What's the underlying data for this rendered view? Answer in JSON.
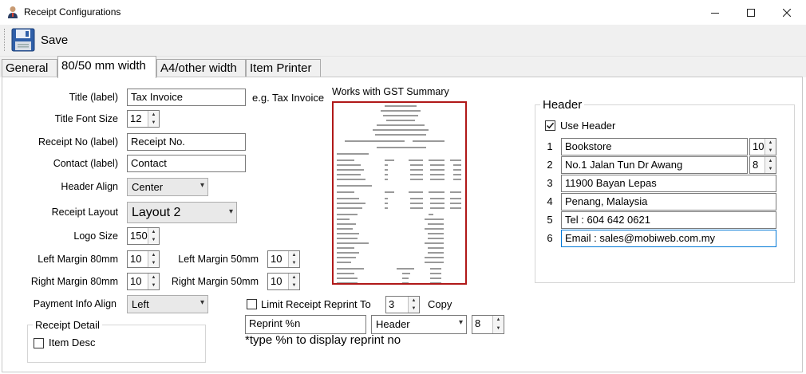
{
  "window": {
    "title": "Receipt Configurations"
  },
  "toolbar": {
    "save_label": "Save"
  },
  "tabs": [
    {
      "label": "General"
    },
    {
      "label": "80/50 mm width"
    },
    {
      "label": "A4/other width"
    },
    {
      "label": "Item Printer"
    }
  ],
  "form": {
    "title_label": "Title (label)",
    "title_value": "Tax Invoice",
    "title_example": "e.g. Tax Invoice",
    "title_font_size_label": "Title Font Size",
    "title_font_size_value": "12",
    "receipt_no_label": "Receipt No (label)",
    "receipt_no_value": "Receipt No.",
    "contact_label": "Contact (label)",
    "contact_value": "Contact",
    "header_align_label": "Header Align",
    "header_align_value": "Center",
    "receipt_layout_label": "Receipt Layout",
    "receipt_layout_value": "Layout 2",
    "logo_size_label": "Logo Size",
    "logo_size_value": "150",
    "left_margin_80_label": "Left Margin 80mm",
    "left_margin_80_value": "10",
    "left_margin_50_label": "Left Margin 50mm",
    "left_margin_50_value": "10",
    "right_margin_80_label": "Right Margin 80mm",
    "right_margin_80_value": "10",
    "right_margin_50_label": "Right Margin 50mm",
    "right_margin_50_value": "10",
    "payment_info_align_label": "Payment Info Align",
    "payment_info_align_value": "Left",
    "receipt_detail_label": "Receipt Detail",
    "item_desc_label": "Item Desc"
  },
  "preview": {
    "label": "Works with GST Summary"
  },
  "reprint": {
    "limit_label": "Limit Receipt Reprint To",
    "limit_value": "3",
    "copy_label": "Copy",
    "text_value": "Reprint %n",
    "position_value": "Header",
    "size_value": "8",
    "hint": "*type %n to display reprint no"
  },
  "header": {
    "group_label": "Header",
    "use_header_label": "Use Header",
    "lines": [
      {
        "num": "1",
        "text": "Bookstore",
        "size": "10"
      },
      {
        "num": "2",
        "text": "No.1 Jalan Tun Dr Awang",
        "size": "8"
      },
      {
        "num": "3",
        "text": "11900 Bayan Lepas"
      },
      {
        "num": "4",
        "text": "Penang, Malaysia"
      },
      {
        "num": "5",
        "text": "Tel : 604 642 0621"
      },
      {
        "num": "6",
        "text": "Email : sales@mobiweb.com.my"
      }
    ]
  }
}
